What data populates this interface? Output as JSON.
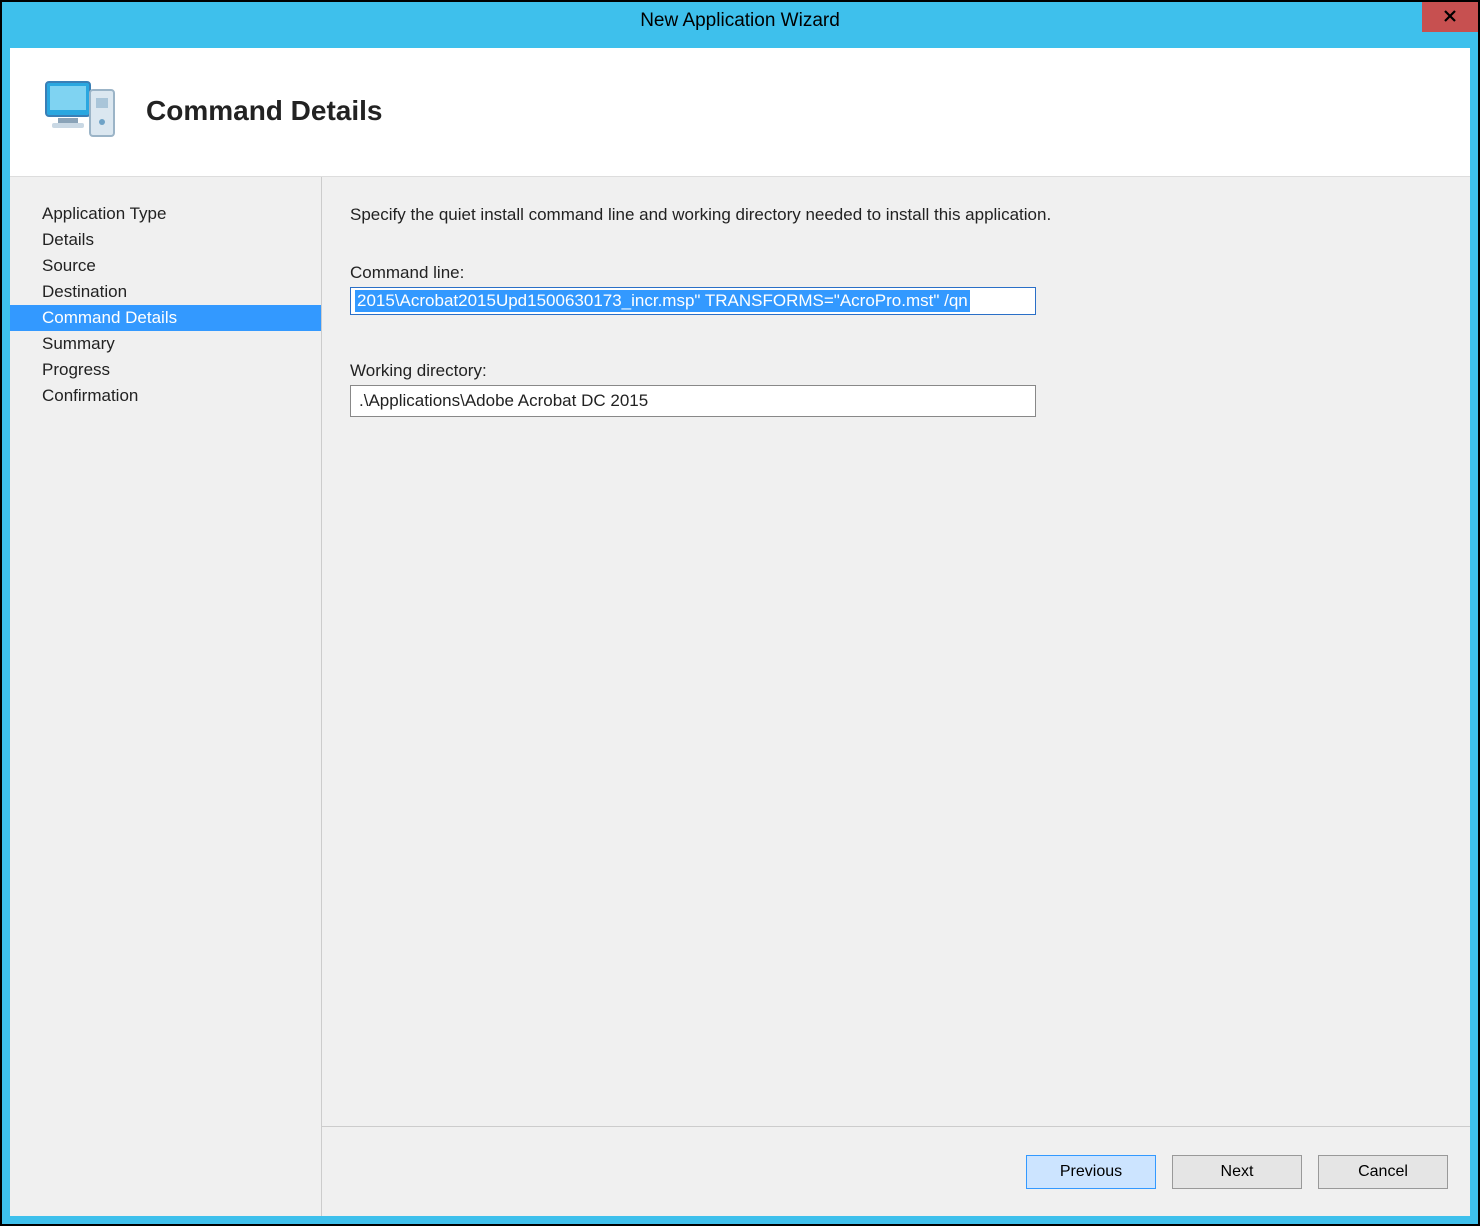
{
  "window": {
    "title": "New Application Wizard"
  },
  "header": {
    "title": "Command Details"
  },
  "sidebar": {
    "items": [
      {
        "label": "Application Type",
        "selected": false
      },
      {
        "label": "Details",
        "selected": false
      },
      {
        "label": "Source",
        "selected": false
      },
      {
        "label": "Destination",
        "selected": false
      },
      {
        "label": "Command Details",
        "selected": true
      },
      {
        "label": "Summary",
        "selected": false
      },
      {
        "label": "Progress",
        "selected": false
      },
      {
        "label": "Confirmation",
        "selected": false
      }
    ]
  },
  "main": {
    "instruction": "Specify the quiet install command line and working directory needed to install this application.",
    "command_line_label": "Command line:",
    "command_line_value": "2015\\Acrobat2015Upd1500630173_incr.msp\" TRANSFORMS=\"AcroPro.mst\"  /qn",
    "working_dir_label": "Working directory:",
    "working_dir_value": ".\\Applications\\Adobe Acrobat DC 2015"
  },
  "footer": {
    "previous": "Previous",
    "next": "Next",
    "cancel": "Cancel"
  }
}
